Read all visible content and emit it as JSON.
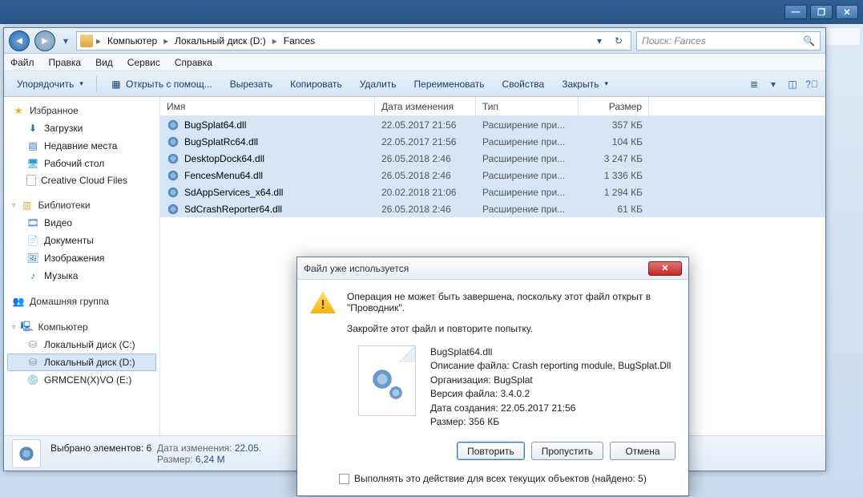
{
  "titlebar": {
    "min": "—",
    "max": "❐",
    "close": "✕"
  },
  "nav": {
    "crumbs": [
      "Компьютер",
      "Локальный диск (D:)",
      "Fances"
    ],
    "search_placeholder": "Поиск: Fances"
  },
  "menu": [
    "Файл",
    "Правка",
    "Вид",
    "Сервис",
    "Справка"
  ],
  "cmdbar": {
    "organize": "Упорядочить",
    "openwith": "Открыть с помощ...",
    "cut": "Вырезать",
    "copy": "Копировать",
    "del": "Удалить",
    "rename": "Переименовать",
    "props": "Свойства",
    "close_btn": "Закрыть"
  },
  "sidebar": {
    "favorites": {
      "title": "Избранное",
      "items": [
        "Загрузки",
        "Недавние места",
        "Рабочий стол",
        "Creative Cloud Files"
      ]
    },
    "libraries": {
      "title": "Библиотеки",
      "items": [
        "Видео",
        "Документы",
        "Изображения",
        "Музыка"
      ]
    },
    "homegroup": {
      "title": "Домашняя группа"
    },
    "computer": {
      "title": "Компьютер",
      "items": [
        "Локальный диск (C:)",
        "Локальный диск (D:)",
        "GRMCEN(X)VO (E:)"
      ]
    }
  },
  "columns": {
    "name": "Имя",
    "date": "Дата изменения",
    "type": "Тип",
    "size": "Размер"
  },
  "files": [
    {
      "name": "BugSplat64.dll",
      "date": "22.05.2017 21:56",
      "type": "Расширение при...",
      "size": "357 КБ"
    },
    {
      "name": "BugSplatRc64.dll",
      "date": "22.05.2017 21:56",
      "type": "Расширение при...",
      "size": "104 КБ"
    },
    {
      "name": "DesktopDock64.dll",
      "date": "26.05.2018 2:46",
      "type": "Расширение при...",
      "size": "3 247 КБ"
    },
    {
      "name": "FencesMenu64.dll",
      "date": "26.05.2018 2:46",
      "type": "Расширение при...",
      "size": "1 336 КБ"
    },
    {
      "name": "SdAppServices_x64.dll",
      "date": "20.02.2018 21:06",
      "type": "Расширение при...",
      "size": "1 294 КБ"
    },
    {
      "name": "SdCrashReporter64.dll",
      "date": "26.05.2018 2:46",
      "type": "Расширение при...",
      "size": "61 КБ"
    }
  ],
  "details": {
    "selected": "Выбрано элементов: 6",
    "date_lbl": "Дата изменения:",
    "date_val": "22.05.",
    "size_lbl": "Размер:",
    "size_val": "6,24 М"
  },
  "status": "Выбрано элементов: 6",
  "dialog": {
    "title": "Файл уже используется",
    "line1": "Операция не может быть завершена, поскольку этот файл открыт в \"Проводник\".",
    "line2": "Закройте этот файл и повторите попытку.",
    "file": {
      "name": "BugSplat64.dll",
      "desc_lbl": "Описание файла:",
      "desc": "Crash reporting module, BugSplat.Dll",
      "org_lbl": "Организация:",
      "org": "BugSplat",
      "ver_lbl": "Версия файла:",
      "ver": "3.4.0.2",
      "created_lbl": "Дата создания:",
      "created": "22.05.2017 21:56",
      "size_lbl": "Размер:",
      "size": "356 КБ"
    },
    "btn_retry": "Повторить",
    "btn_skip": "Пропустить",
    "btn_cancel": "Отмена",
    "checkbox": "Выполнять это действие для всех текущих объектов (найдено: 5)"
  }
}
